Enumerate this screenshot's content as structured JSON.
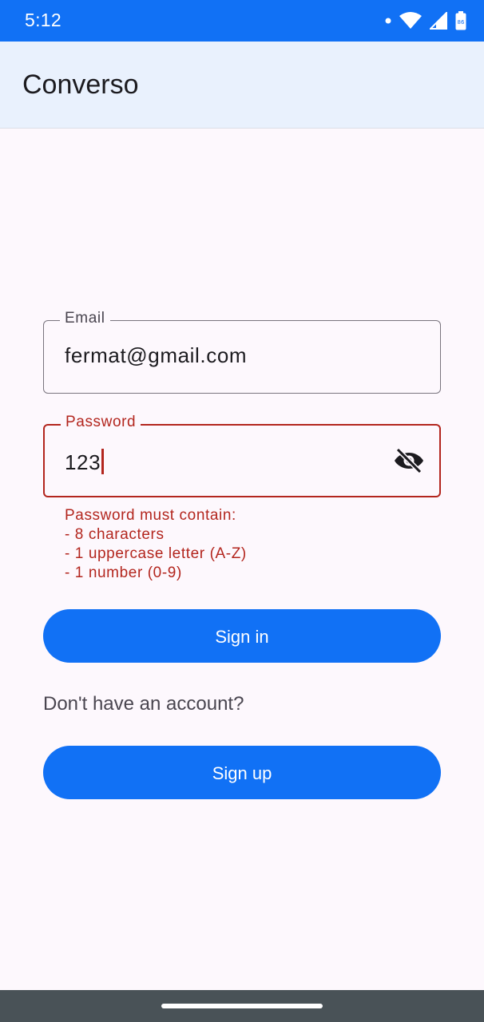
{
  "status_bar": {
    "time": "5:12",
    "icons": [
      "dot-icon",
      "wifi-icon",
      "signal-icon",
      "battery-icon"
    ]
  },
  "app_bar": {
    "title": "Converso"
  },
  "form": {
    "email": {
      "label": "Email",
      "value": "fermat@gmail.com"
    },
    "password": {
      "label": "Password",
      "value": "123",
      "toggle_icon": "visibility-off-icon",
      "error_lines": [
        "Password must contain:",
        "- 8 characters",
        "- 1 uppercase letter (A-Z)",
        "- 1 number (0-9)"
      ]
    },
    "sign_in_label": "Sign in",
    "no_account_text": "Don't have an account?",
    "sign_up_label": "Sign up"
  },
  "colors": {
    "primary": "#1171f5",
    "error": "#b3261e",
    "app_bar_bg": "#e9f1fd",
    "background": "#fdf8fd",
    "nav_bar": "#495257"
  }
}
